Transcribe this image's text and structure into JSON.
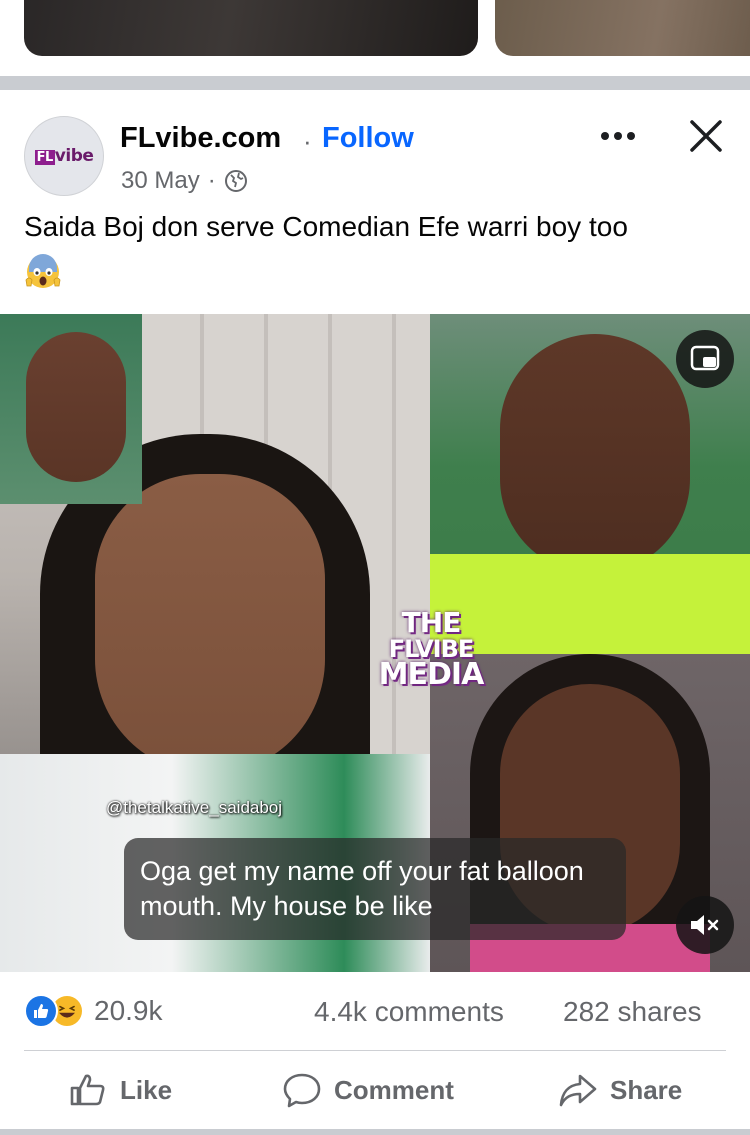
{
  "post": {
    "page_name": "FLvibe.com",
    "separator": "·",
    "follow_label": "Follow",
    "date": "30 May",
    "date_separator": "·",
    "audience_icon": "globe-icon",
    "more_icon": "more-options-icon",
    "close_icon": "close-icon",
    "avatar_logo_fl": "FL",
    "avatar_logo_rest": "vibe",
    "text": "Saida Boj don serve Comedian Efe warri boy too",
    "emoji": "face-screaming-in-fear"
  },
  "video": {
    "watermark": [
      "THE",
      "FLVIBE",
      "MEDIA"
    ],
    "handle": "@thetalkative_saidaboj",
    "caption": "Oga get my name off your fat balloon mouth. My house be like",
    "pip_icon": "picture-in-picture-icon",
    "mute_icon": "muted-speaker-icon"
  },
  "engagement": {
    "reactions": [
      "like",
      "haha"
    ],
    "reaction_count": "20.9k",
    "comments": "4.4k comments",
    "shares": "282 shares"
  },
  "actions": {
    "like_label": "Like",
    "comment_label": "Comment",
    "share_label": "Share"
  },
  "colors": {
    "brand_blue": "#0866ff",
    "secondary_text": "#65676b",
    "separator_gray": "#c9ccd1"
  }
}
